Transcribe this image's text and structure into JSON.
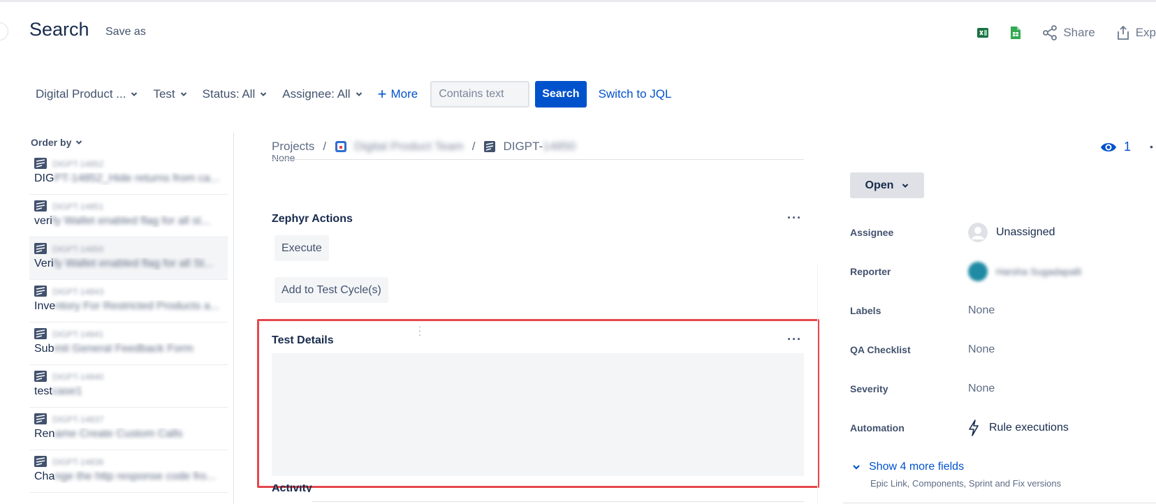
{
  "header": {
    "title": "Search",
    "save_as": "Save as",
    "share_label": "Share",
    "export_label": "Exp"
  },
  "filters": {
    "project": "Digital Product ...",
    "type": "Test",
    "status": "Status: All",
    "assignee": "Assignee: All",
    "more": "More",
    "search_placeholder": "Contains text",
    "search_button": "Search",
    "switch_jql": "Switch to JQL"
  },
  "issue_list": {
    "order_by": "Order by",
    "items": [
      {
        "key": "DIGPT-14852",
        "summary_visible": "DIG",
        "summary_blurred": "PT-14852_Hide returns from ca..."
      },
      {
        "key": "DIGPT-14851",
        "summary_visible": "veri",
        "summary_blurred": "fy Wallet enabled flag for all st..."
      },
      {
        "key": "DIGPT-14850",
        "summary_visible": "Veri",
        "summary_blurred": "fy Wallet enabled flag for all St..."
      },
      {
        "key": "DIGPT-14843",
        "summary_visible": "Inve",
        "summary_blurred": "ntory For Restricted Products a..."
      },
      {
        "key": "DIGPT-14841",
        "summary_visible": "Sub",
        "summary_blurred": "mit General Feedback Form"
      },
      {
        "key": "DIGPT-14840",
        "summary_visible": "test",
        "summary_blurred": "case1"
      },
      {
        "key": "DIGPT-14837",
        "summary_visible": "Ren",
        "summary_blurred": "ame Create Custom Calls"
      },
      {
        "key": "DIGPT-14836",
        "summary_visible": "Cha",
        "summary_blurred": "nge the http response code fro..."
      }
    ]
  },
  "breadcrumb": {
    "projects": "Projects",
    "separator": "/",
    "project_name": "Digital Product Team",
    "issue_prefix": "DIGPT-",
    "issue_suffix": "14850"
  },
  "issue": {
    "watch_count": "1",
    "prev_value": "None",
    "zephyr": {
      "title": "Zephyr Actions",
      "execute": "Execute",
      "add_to_cycle": "Add to Test Cycle(s)"
    },
    "test_details_title": "Test Details",
    "activity_title": "Activity",
    "more_dots": "···"
  },
  "sidebar": {
    "status": "Open",
    "fields": [
      {
        "label": "Assignee",
        "value": "Unassigned"
      },
      {
        "label": "Reporter",
        "value": "Harsha Sugadapalli"
      },
      {
        "label": "Labels",
        "value": "None"
      },
      {
        "label": "QA Checklist",
        "value": "None"
      },
      {
        "label": "Severity",
        "value": "None"
      },
      {
        "label": "Automation",
        "value": "Rule executions"
      }
    ],
    "show_more": "Show 4 more fields",
    "show_more_sub": "Epic Link, Components, Sprint and Fix versions"
  },
  "colors": {
    "primary": "#0052cc",
    "highlight_border": "#e5484d",
    "excel_green": "#1d7044",
    "sheets_green": "#34a853"
  }
}
